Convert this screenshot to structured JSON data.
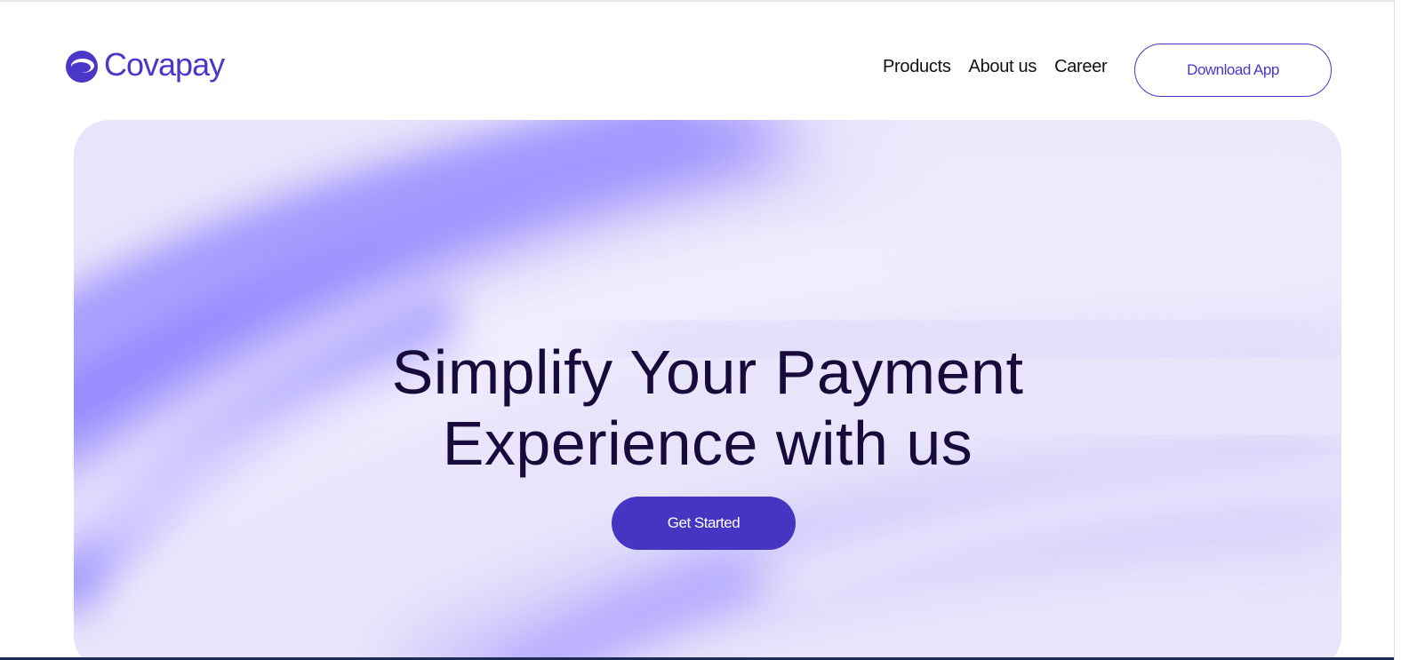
{
  "brand": {
    "name": "Covapay",
    "logo_icon": "covapay-logo-icon",
    "color": "#4a37c8"
  },
  "nav": {
    "items": [
      {
        "label": "Products"
      },
      {
        "label": "About us"
      },
      {
        "label": "Career"
      }
    ],
    "download_label": "Download App"
  },
  "hero": {
    "title_line1": "Simplify Your Payment",
    "title_line2": "Experience with us",
    "cta_label": "Get Started",
    "title_color": "#180a3a",
    "cta_color": "#4634c2",
    "background_base": "#e7e4fb",
    "wave_accent": "#7b6cff"
  }
}
